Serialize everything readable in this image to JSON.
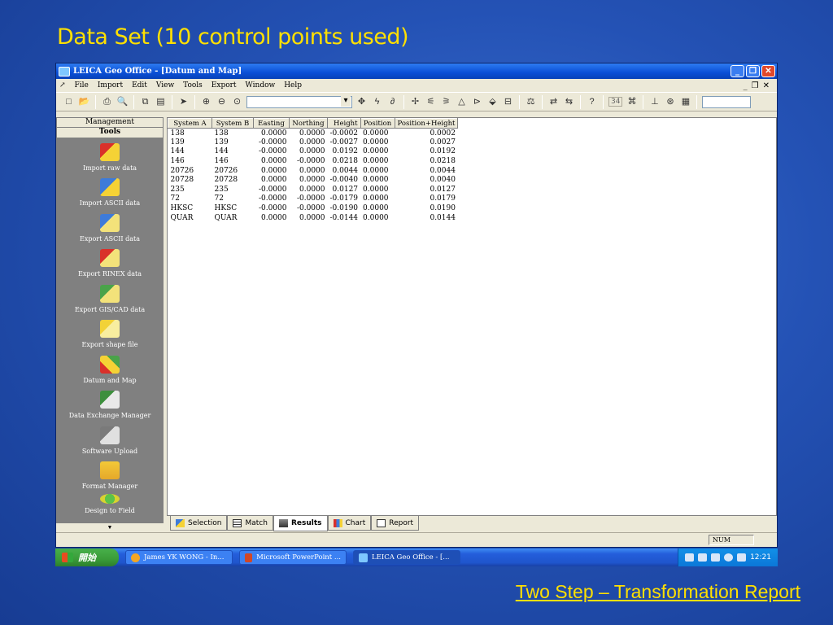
{
  "slide": {
    "title": "Data Set (10 control points used)",
    "footer": "Two Step – Transformation Report"
  },
  "window": {
    "title": "LEICA Geo Office - [Datum and Map]"
  },
  "menu": [
    "File",
    "Import",
    "Edit",
    "View",
    "Tools",
    "Export",
    "Window",
    "Help"
  ],
  "toolbar": {
    "count": "34"
  },
  "leftpanel": {
    "header": "Management",
    "section": "Tools",
    "items": [
      {
        "label": "Import raw data",
        "icon": "import-raw-icon"
      },
      {
        "label": "Import ASCII data",
        "icon": "import-ascii-icon"
      },
      {
        "label": "Export ASCII data",
        "icon": "export-ascii-icon"
      },
      {
        "label": "Export RINEX data",
        "icon": "export-rinex-icon"
      },
      {
        "label": "Export GIS/CAD data",
        "icon": "export-gis-icon"
      },
      {
        "label": "Export shape file",
        "icon": "export-shape-icon"
      },
      {
        "label": "Datum and Map",
        "icon": "datum-map-icon"
      },
      {
        "label": "Data Exchange Manager",
        "icon": "data-exchange-icon"
      },
      {
        "label": "Software Upload",
        "icon": "software-upload-icon"
      },
      {
        "label": "Format Manager",
        "icon": "format-manager-icon"
      },
      {
        "label": "Design to Field",
        "icon": "design-field-icon"
      }
    ]
  },
  "results": {
    "columns": [
      "System A",
      "System B",
      "Easting",
      "Northing",
      "Height",
      "Position",
      "Position+Height"
    ],
    "rows": [
      [
        "138",
        "138",
        "0.0000",
        "0.0000",
        "-0.0002",
        "0.0000",
        "0.0002"
      ],
      [
        "139",
        "139",
        "-0.0000",
        "0.0000",
        "-0.0027",
        "0.0000",
        "0.0027"
      ],
      [
        "144",
        "144",
        "-0.0000",
        "0.0000",
        "0.0192",
        "0.0000",
        "0.0192"
      ],
      [
        "146",
        "146",
        "0.0000",
        "-0.0000",
        "0.0218",
        "0.0000",
        "0.0218"
      ],
      [
        "20726",
        "20726",
        "0.0000",
        "0.0000",
        "0.0044",
        "0.0000",
        "0.0044"
      ],
      [
        "20728",
        "20728",
        "0.0000",
        "0.0000",
        "-0.0040",
        "0.0000",
        "0.0040"
      ],
      [
        "235",
        "235",
        "-0.0000",
        "0.0000",
        "0.0127",
        "0.0000",
        "0.0127"
      ],
      [
        "72",
        "72",
        "-0.0000",
        "-0.0000",
        "-0.0179",
        "0.0000",
        "0.0179"
      ],
      [
        "HKSC",
        "HKSC",
        "-0.0000",
        "-0.0000",
        "-0.0190",
        "0.0000",
        "0.0190"
      ],
      [
        "QUAR",
        "QUAR",
        "0.0000",
        "0.0000",
        "-0.0144",
        "0.0000",
        "0.0144"
      ]
    ]
  },
  "tabs": [
    "Selection",
    "Match",
    "Results",
    "Chart",
    "Report"
  ],
  "statusbar": {
    "num": "NUM"
  },
  "taskbar": {
    "start": "開始",
    "tasks": [
      "James YK WONG - In...",
      "Microsoft PowerPoint ...",
      "LEICA Geo Office - [..."
    ],
    "clock": "12:21"
  }
}
